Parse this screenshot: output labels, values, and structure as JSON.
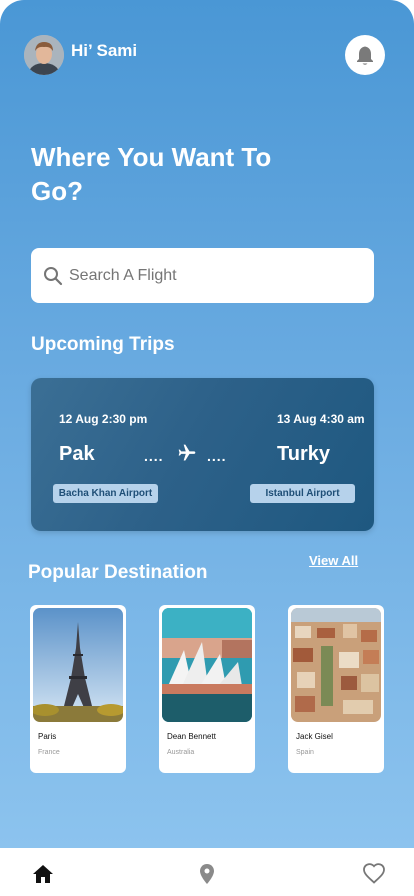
{
  "header": {
    "greeting": "Hi’ Sami",
    "avatar": "user-avatar",
    "notification_icon": "bell-icon"
  },
  "headline": "Where You Want To Go?",
  "search": {
    "placeholder": "Search A Flight",
    "icon": "search-icon"
  },
  "upcoming": {
    "title": "Upcoming Trips",
    "trip": {
      "departure_time": "12 Aug 2:30 pm",
      "arrival_time": "13 Aug 4:30 am",
      "from_city": "Pak",
      "to_city": "Turky",
      "dots_left": "....",
      "dots_right": "....",
      "from_airport": "Bacha Khan Airport",
      "to_airport": "Istanbul Airport",
      "icon": "plane-icon"
    }
  },
  "popular": {
    "title": "Popular Destination",
    "view_all": "View All",
    "items": [
      {
        "name": "Paris",
        "country": "France"
      },
      {
        "name": "Dean Bennett",
        "country": "Australia"
      },
      {
        "name": "Jack Gisel",
        "country": "Spain"
      }
    ]
  },
  "nav": {
    "items": [
      "home-icon",
      "location-icon",
      "heart-icon"
    ]
  },
  "colors": {
    "background_top": "#4a97d5",
    "background_bottom": "#8cc3ee",
    "card": "#2d6189",
    "airport_chip": "#b6d2eb"
  }
}
